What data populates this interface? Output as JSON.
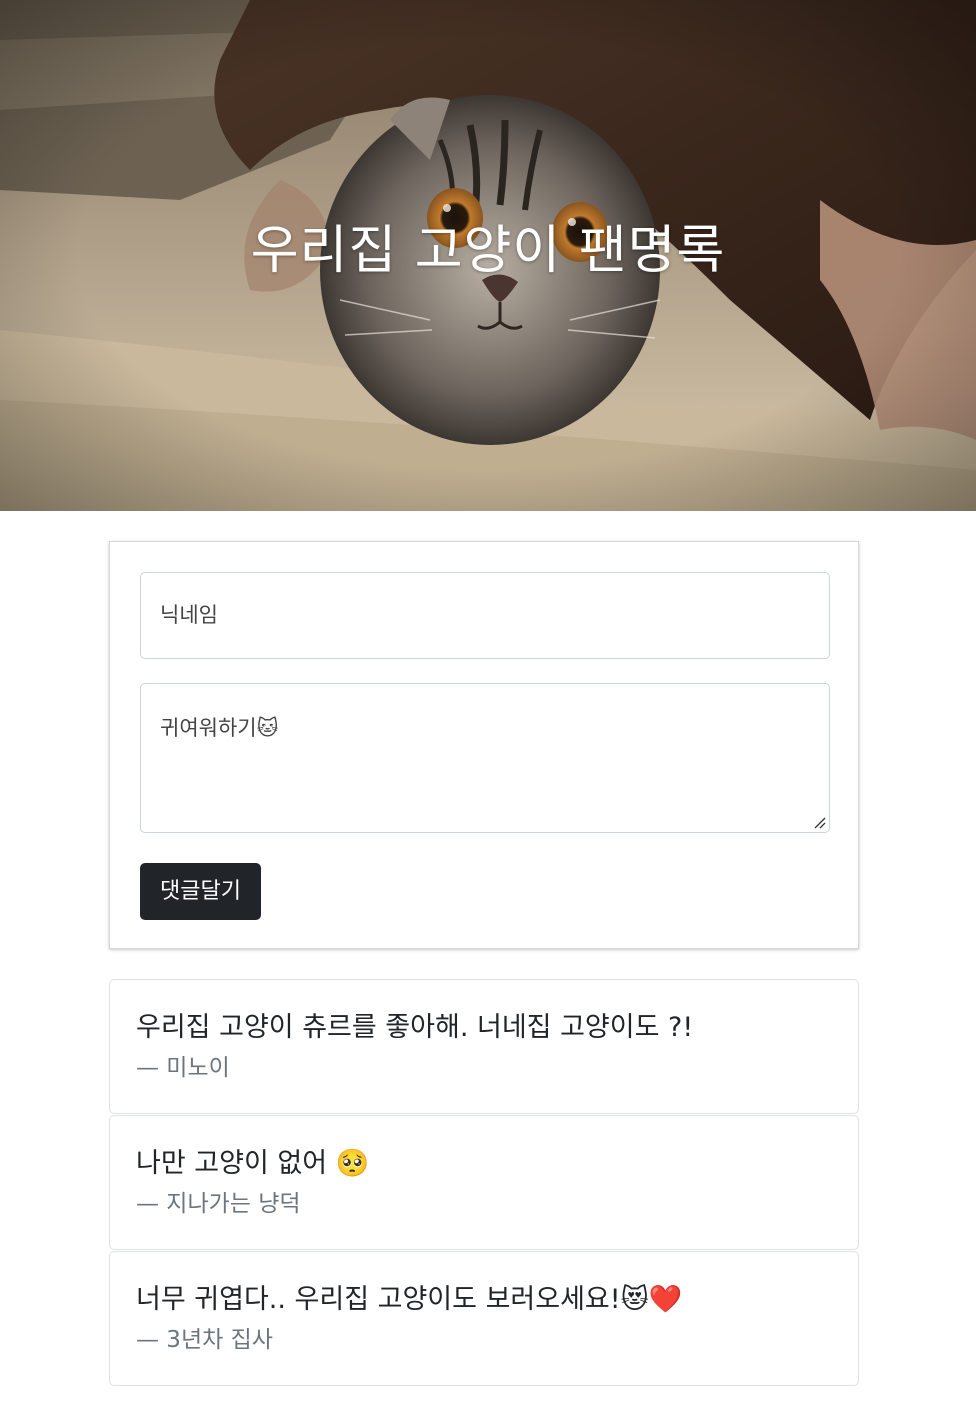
{
  "hero": {
    "title": "우리집 고양이 팬명록",
    "image_subject": "cat-under-blanket-photo"
  },
  "form": {
    "nickname_placeholder": "닉네임",
    "message_placeholder": "귀여워하기🐱",
    "submit_label": "댓글달기"
  },
  "comments": [
    {
      "text": "우리집 고양이 츄르를 좋아해. 너네집 고양이도 ?!",
      "author": "— 미노이"
    },
    {
      "text": "나만 고양이 없어 🥺",
      "author": "— 지나가는 냥덕"
    },
    {
      "text": "너무 귀엽다.. 우리집 고양이도 보러오세요!😻❤️",
      "author": "— 3년차 집사"
    }
  ],
  "colors": {
    "button_bg": "#212529",
    "button_text": "#ffffff",
    "author_text": "#6c757d",
    "card_border": "#dee2e6"
  }
}
